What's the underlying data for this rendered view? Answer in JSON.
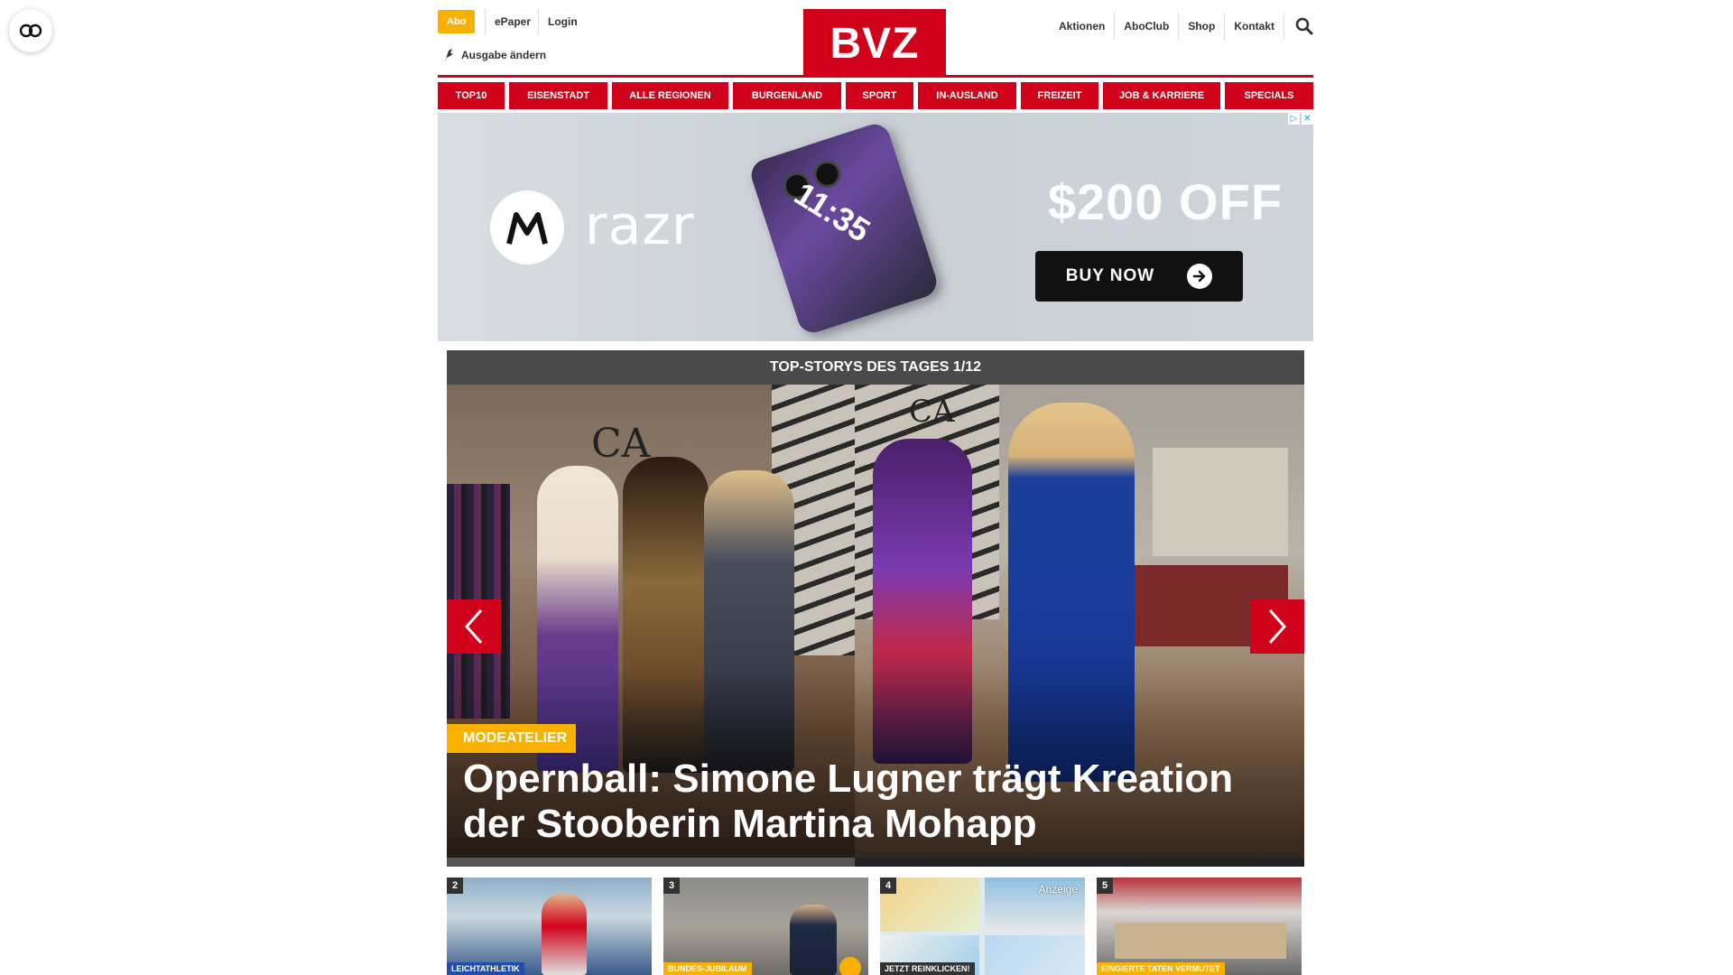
{
  "header": {
    "abo_label": "Abo",
    "epaper_label": "ePaper",
    "login_label": "Login",
    "edition_label": "Ausgabe ändern",
    "logo_text": "BVZ",
    "right_nav": [
      "Aktionen",
      "AboClub",
      "Shop",
      "Kontakt"
    ]
  },
  "main_nav": [
    "TOP10",
    "EISENSTADT",
    "ALLE REGIONEN",
    "BURGENLAND",
    "SPORT",
    "IN-AUSLAND",
    "FREIZEIT",
    "JOB & KARRIERE",
    "SPECIALS"
  ],
  "ad": {
    "brand": "razr",
    "phone_time": "11:35",
    "headline": "$200 OFF",
    "cta": "BUY NOW"
  },
  "topstories": {
    "title": "TOP-STORYS DES TAGES 1/12",
    "kicker": "MODEATELIER",
    "headline": "Opernball: Simone Lugner trägt Kreation der Stooberin Martina Mohapp"
  },
  "teasers": [
    {
      "num": "2",
      "tag": "LEICHTATHLETIK",
      "tag_color": "#1f4fa8"
    },
    {
      "num": "3",
      "tag": "BUNDES-JUBILÄUM",
      "tag_color": "#f8b100"
    },
    {
      "num": "4",
      "tag": "JETZT REINKLICKEN!",
      "tag_color": "#333333",
      "anzeige": "Anzeige"
    },
    {
      "num": "5",
      "tag": "EINGIERTE TATEN VERMUTET",
      "tag_color": "#f8b100"
    }
  ],
  "colors": {
    "brand_red": "#d0021b",
    "abo_yellow": "#f8b100",
    "bar_dark": "#4a4a4a"
  }
}
